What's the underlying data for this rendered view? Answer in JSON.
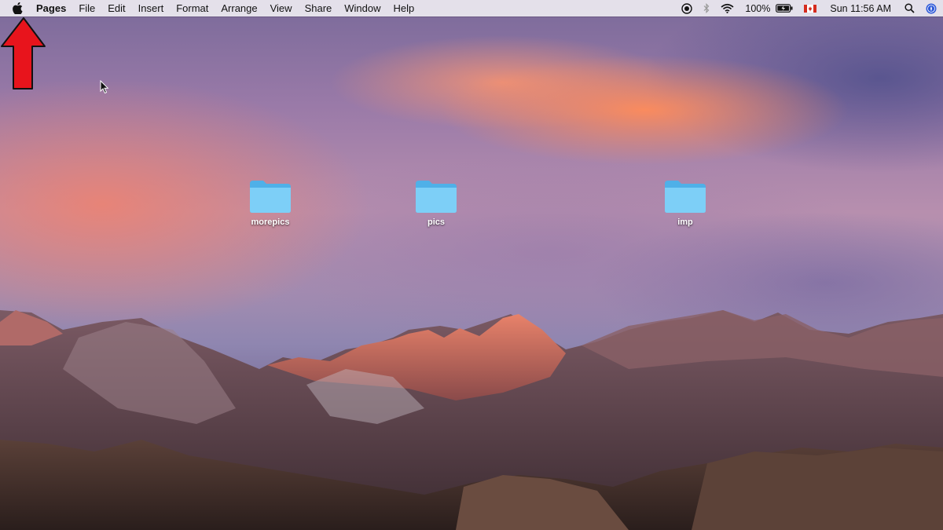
{
  "menubar": {
    "app_name": "Pages",
    "menus": [
      "File",
      "Edit",
      "Insert",
      "Format",
      "Arrange",
      "View",
      "Share",
      "Window",
      "Help"
    ],
    "status": {
      "battery_percent": "100%",
      "clock": "Sun 11:56 AM",
      "keyboard_flag_icon": "canada-flag-icon"
    }
  },
  "desktop": {
    "folders": [
      {
        "label": "morepics"
      },
      {
        "label": "pics"
      },
      {
        "label": "imp"
      }
    ]
  },
  "colors": {
    "folder": "#6cc4f2",
    "arrow": "#e8141c"
  }
}
